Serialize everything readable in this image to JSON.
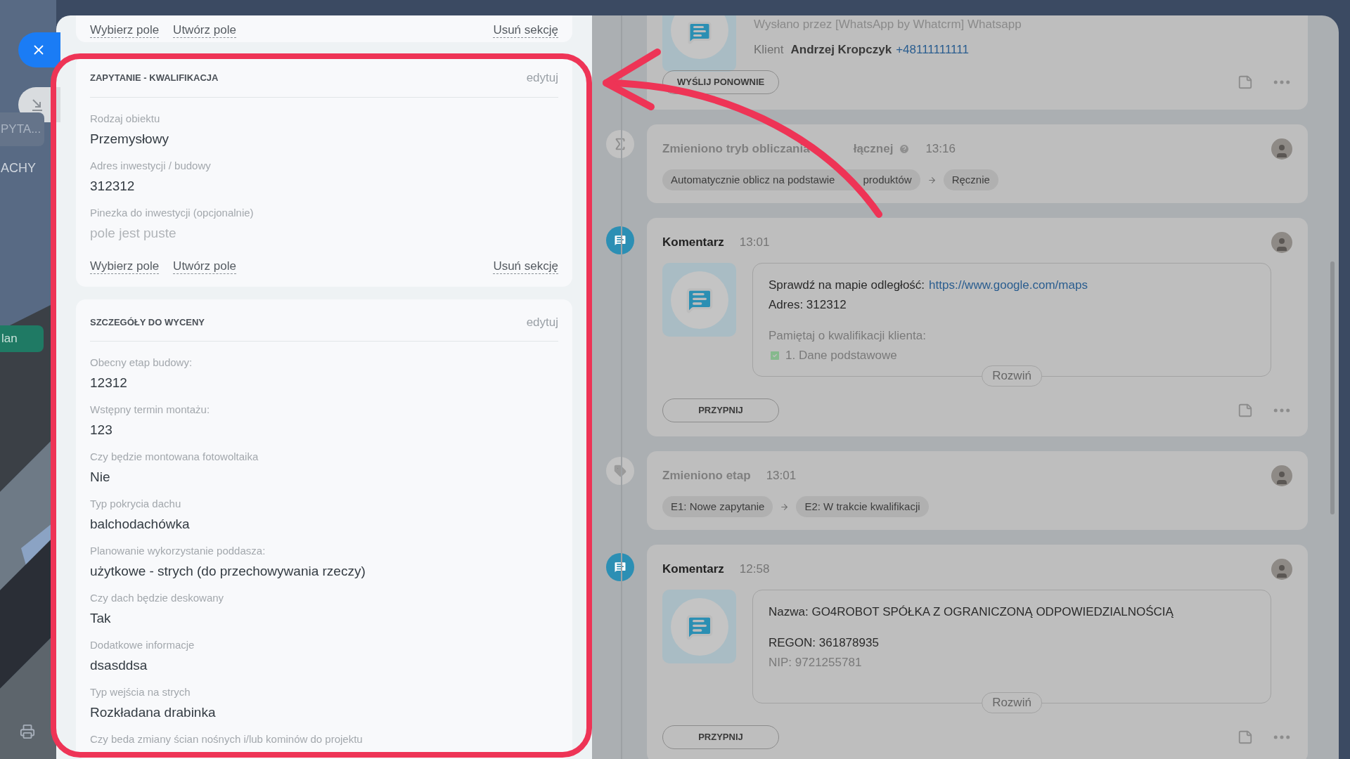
{
  "left_rail": {
    "tab": "PYTA...",
    "label": "ACHY",
    "green_button": "lan"
  },
  "panel": {
    "sections": [
      {
        "kind": "footer",
        "links": [
          "Wybierz pole",
          "Utwórz pole"
        ],
        "delete": "Usuń sekcję"
      },
      {
        "kind": "section",
        "title": "ZAPYTANIE - KWALIFIKACJA",
        "edit": "edytuj",
        "fields": [
          {
            "label": "Rodzaj obiektu",
            "value": "Przemysłowy",
            "empty": false
          },
          {
            "label": "Adres inwestycji / budowy",
            "value": "312312",
            "empty": false
          },
          {
            "label": "Pinezka do inwestycji (opcjonalnie)",
            "value": "pole jest puste",
            "empty": true
          }
        ],
        "links": [
          "Wybierz pole",
          "Utwórz pole"
        ],
        "delete": "Usuń sekcję"
      },
      {
        "kind": "section",
        "title": "SZCZEGÓŁY DO WYCENY",
        "edit": "edytuj",
        "fields": [
          {
            "label": "Obecny etap budowy:",
            "value": "12312",
            "empty": false
          },
          {
            "label": "Wstępny termin montażu:",
            "value": "123",
            "empty": false
          },
          {
            "label": "Czy będzie montowana fotowoltaika",
            "value": "Nie",
            "empty": false
          },
          {
            "label": "Typ pokrycia dachu",
            "value": "balchodachówka",
            "empty": false
          },
          {
            "label": "Planowanie wykorzystanie poddasza:",
            "value": "użytkowe - strych (do przechowywania rzeczy)",
            "empty": false
          },
          {
            "label": "Czy dach będzie deskowany",
            "value": "Tak",
            "empty": false
          },
          {
            "label": "Dodatkowe informacje",
            "value": "dsasddsa",
            "empty": false
          },
          {
            "label": "Typ wejścia na strych",
            "value": "Rozkładana drabinka",
            "empty": false
          }
        ],
        "cut_label": "Czy beda zmiany ścian nośnych i/lub kominów do projektu"
      }
    ]
  },
  "timeline": [
    {
      "kind": "message",
      "lines": [
        "Wysłano przez [WhatsApp by Whatcrm] Whatsapp"
      ],
      "client_label": "Klient",
      "client_name": "Andrzej Kropczyk",
      "phone": "+48111111111",
      "button": "WYŚLIJ PONOWNIE"
    },
    {
      "kind": "total_change",
      "title": [
        "Zmieniono tryb obliczania",
        "łącznej"
      ],
      "time": "13:16",
      "from": [
        "Automatycznie oblicz na podstawie",
        "produktów"
      ],
      "to": "Ręcznie"
    },
    {
      "kind": "comment",
      "title": "Komentarz",
      "time": "13:01",
      "paragraphs": [
        [
          {
            "text": "Sprawdź na mapie odległość:",
            "link": "https://www.google.com/maps",
            "faded": false
          },
          {
            "text": "Adres: 312312",
            "faded": false
          }
        ],
        [
          {
            "text": "Pamiętaj o kwalifikacji klienta:",
            "faded": true
          },
          {
            "text": "1. Dane podstawowe",
            "faded": true,
            "checked": true
          }
        ]
      ],
      "expand": "Rozwiń",
      "pin": "PRZYPNIJ"
    },
    {
      "kind": "stage_change",
      "title": [
        "Zmieniono etap"
      ],
      "time": "13:01",
      "from": [
        "E1: Nowe zapytanie"
      ],
      "to": "E2: W trakcie kwalifikacji"
    },
    {
      "kind": "comment",
      "title": "Komentarz",
      "time": "12:58",
      "paragraphs": [
        [
          {
            "text": "Nazwa: GO4ROBOT SPÓŁKA Z OGRANICZONĄ ODPOWIEDZIALNOŚCIĄ",
            "faded": false
          }
        ],
        [
          {
            "text": "REGON: 361878935",
            "faded": false
          },
          {
            "text": "NIP: 9721255781",
            "faded": true
          }
        ]
      ],
      "expand": "Rozwiń",
      "pin": "PRZYPNIJ"
    }
  ]
}
